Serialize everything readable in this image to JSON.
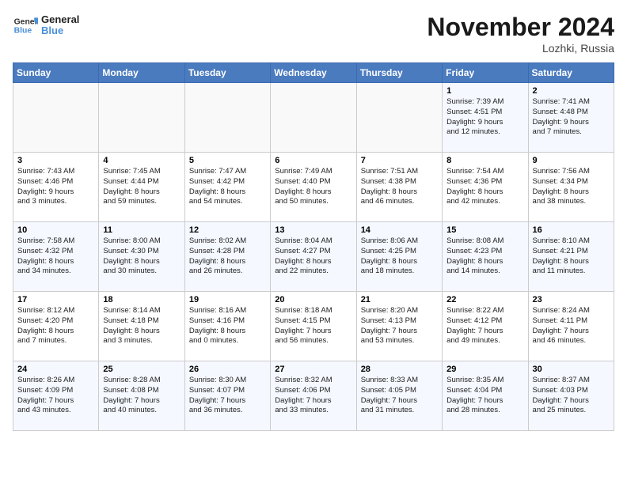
{
  "header": {
    "logo_general": "General",
    "logo_blue": "Blue",
    "title": "November 2024",
    "subtitle": "Lozhki, Russia"
  },
  "weekdays": [
    "Sunday",
    "Monday",
    "Tuesday",
    "Wednesday",
    "Thursday",
    "Friday",
    "Saturday"
  ],
  "weeks": [
    [
      {
        "day": "",
        "info": ""
      },
      {
        "day": "",
        "info": ""
      },
      {
        "day": "",
        "info": ""
      },
      {
        "day": "",
        "info": ""
      },
      {
        "day": "",
        "info": ""
      },
      {
        "day": "1",
        "info": "Sunrise: 7:39 AM\nSunset: 4:51 PM\nDaylight: 9 hours\nand 12 minutes."
      },
      {
        "day": "2",
        "info": "Sunrise: 7:41 AM\nSunset: 4:48 PM\nDaylight: 9 hours\nand 7 minutes."
      }
    ],
    [
      {
        "day": "3",
        "info": "Sunrise: 7:43 AM\nSunset: 4:46 PM\nDaylight: 9 hours\nand 3 minutes."
      },
      {
        "day": "4",
        "info": "Sunrise: 7:45 AM\nSunset: 4:44 PM\nDaylight: 8 hours\nand 59 minutes."
      },
      {
        "day": "5",
        "info": "Sunrise: 7:47 AM\nSunset: 4:42 PM\nDaylight: 8 hours\nand 54 minutes."
      },
      {
        "day": "6",
        "info": "Sunrise: 7:49 AM\nSunset: 4:40 PM\nDaylight: 8 hours\nand 50 minutes."
      },
      {
        "day": "7",
        "info": "Sunrise: 7:51 AM\nSunset: 4:38 PM\nDaylight: 8 hours\nand 46 minutes."
      },
      {
        "day": "8",
        "info": "Sunrise: 7:54 AM\nSunset: 4:36 PM\nDaylight: 8 hours\nand 42 minutes."
      },
      {
        "day": "9",
        "info": "Sunrise: 7:56 AM\nSunset: 4:34 PM\nDaylight: 8 hours\nand 38 minutes."
      }
    ],
    [
      {
        "day": "10",
        "info": "Sunrise: 7:58 AM\nSunset: 4:32 PM\nDaylight: 8 hours\nand 34 minutes."
      },
      {
        "day": "11",
        "info": "Sunrise: 8:00 AM\nSunset: 4:30 PM\nDaylight: 8 hours\nand 30 minutes."
      },
      {
        "day": "12",
        "info": "Sunrise: 8:02 AM\nSunset: 4:28 PM\nDaylight: 8 hours\nand 26 minutes."
      },
      {
        "day": "13",
        "info": "Sunrise: 8:04 AM\nSunset: 4:27 PM\nDaylight: 8 hours\nand 22 minutes."
      },
      {
        "day": "14",
        "info": "Sunrise: 8:06 AM\nSunset: 4:25 PM\nDaylight: 8 hours\nand 18 minutes."
      },
      {
        "day": "15",
        "info": "Sunrise: 8:08 AM\nSunset: 4:23 PM\nDaylight: 8 hours\nand 14 minutes."
      },
      {
        "day": "16",
        "info": "Sunrise: 8:10 AM\nSunset: 4:21 PM\nDaylight: 8 hours\nand 11 minutes."
      }
    ],
    [
      {
        "day": "17",
        "info": "Sunrise: 8:12 AM\nSunset: 4:20 PM\nDaylight: 8 hours\nand 7 minutes."
      },
      {
        "day": "18",
        "info": "Sunrise: 8:14 AM\nSunset: 4:18 PM\nDaylight: 8 hours\nand 3 minutes."
      },
      {
        "day": "19",
        "info": "Sunrise: 8:16 AM\nSunset: 4:16 PM\nDaylight: 8 hours\nand 0 minutes."
      },
      {
        "day": "20",
        "info": "Sunrise: 8:18 AM\nSunset: 4:15 PM\nDaylight: 7 hours\nand 56 minutes."
      },
      {
        "day": "21",
        "info": "Sunrise: 8:20 AM\nSunset: 4:13 PM\nDaylight: 7 hours\nand 53 minutes."
      },
      {
        "day": "22",
        "info": "Sunrise: 8:22 AM\nSunset: 4:12 PM\nDaylight: 7 hours\nand 49 minutes."
      },
      {
        "day": "23",
        "info": "Sunrise: 8:24 AM\nSunset: 4:11 PM\nDaylight: 7 hours\nand 46 minutes."
      }
    ],
    [
      {
        "day": "24",
        "info": "Sunrise: 8:26 AM\nSunset: 4:09 PM\nDaylight: 7 hours\nand 43 minutes."
      },
      {
        "day": "25",
        "info": "Sunrise: 8:28 AM\nSunset: 4:08 PM\nDaylight: 7 hours\nand 40 minutes."
      },
      {
        "day": "26",
        "info": "Sunrise: 8:30 AM\nSunset: 4:07 PM\nDaylight: 7 hours\nand 36 minutes."
      },
      {
        "day": "27",
        "info": "Sunrise: 8:32 AM\nSunset: 4:06 PM\nDaylight: 7 hours\nand 33 minutes."
      },
      {
        "day": "28",
        "info": "Sunrise: 8:33 AM\nSunset: 4:05 PM\nDaylight: 7 hours\nand 31 minutes."
      },
      {
        "day": "29",
        "info": "Sunrise: 8:35 AM\nSunset: 4:04 PM\nDaylight: 7 hours\nand 28 minutes."
      },
      {
        "day": "30",
        "info": "Sunrise: 8:37 AM\nSunset: 4:03 PM\nDaylight: 7 hours\nand 25 minutes."
      }
    ]
  ]
}
